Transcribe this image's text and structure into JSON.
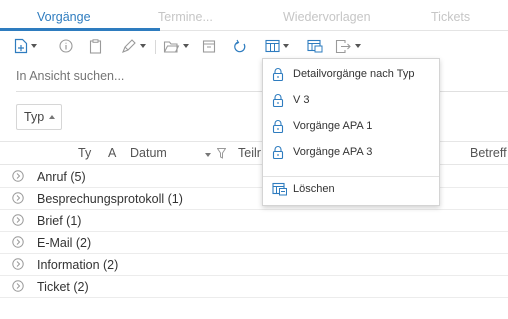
{
  "tabs": [
    {
      "label": "Vorgänge",
      "active": true
    },
    {
      "label": "Termine..."
    },
    {
      "label": "Wiedervorlagen"
    },
    {
      "label": "Tickets"
    }
  ],
  "toolbar": {
    "icons": [
      "new-item-icon",
      "info-icon",
      "clipboard-icon",
      "edit-pen-icon",
      "open-folder-icon",
      "archive-icon",
      "refresh-icon",
      "view-columns-icon",
      "view-manage-icon",
      "export-icon"
    ]
  },
  "search": {
    "placeholder": "In Ansicht suchen..."
  },
  "grouping": {
    "chip_label": "Typ"
  },
  "columns": {
    "typ": "Ty",
    "a": "A",
    "datum": "Datum",
    "teil": "Teilr",
    "betreff": "Betreff"
  },
  "groups": [
    {
      "label": "Anruf (5)"
    },
    {
      "label": "Besprechungsprotokoll (1)"
    },
    {
      "label": "Brief (1)"
    },
    {
      "label": "E-Mail (2)"
    },
    {
      "label": "Information (2)"
    },
    {
      "label": "Ticket (2)"
    }
  ],
  "view_menu": {
    "items": [
      {
        "label": "Detailvorgänge nach Typ",
        "icon": "lock-icon"
      },
      {
        "label": "V 3",
        "icon": "lock-icon"
      },
      {
        "label": "Vorgänge APA 1",
        "icon": "lock-icon"
      },
      {
        "label": "Vorgänge APA 3",
        "icon": "lock-icon"
      }
    ],
    "delete_label": "Löschen"
  },
  "colors": {
    "accent": "#2e7cbf",
    "muted": "#c6c6c6"
  }
}
